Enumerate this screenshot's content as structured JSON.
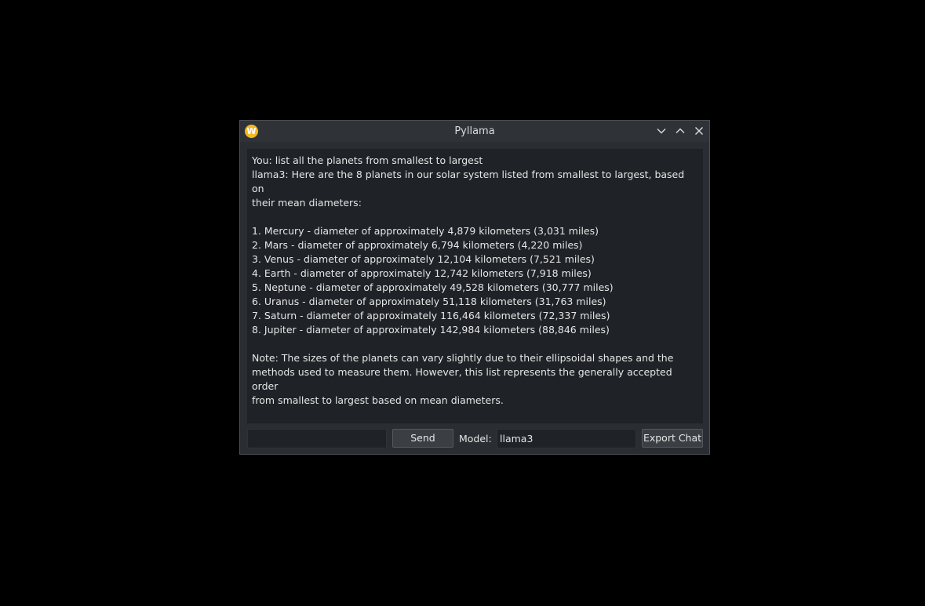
{
  "window": {
    "title": "Pyllama",
    "app_icon": {
      "name": "app-logo-icon",
      "glyph": "W",
      "color": "#f5b81e"
    }
  },
  "title_controls": {
    "minimize_icon": "chevron-down-icon",
    "maximize_icon": "chevron-up-icon",
    "close_icon": "close-icon"
  },
  "chat": {
    "lines": [
      "You: list all the planets from smallest to largest",
      "llama3: Here are the 8 planets in our solar system listed from smallest to largest, based on",
      "their mean diameters:",
      "",
      "1. Mercury - diameter of approximately 4,879 kilometers (3,031 miles)",
      "2. Mars - diameter of approximately 6,794 kilometers (4,220 miles)",
      "3. Venus - diameter of approximately 12,104 kilometers (7,521 miles)",
      "4. Earth - diameter of approximately 12,742 kilometers (7,918 miles)",
      "5. Neptune - diameter of approximately 49,528 kilometers (30,777 miles)",
      "6. Uranus - diameter of approximately 51,118 kilometers (31,763 miles)",
      "7. Saturn - diameter of approximately 116,464 kilometers (72,337 miles)",
      "8. Jupiter - diameter of approximately 142,984 kilometers (88,846 miles)",
      "",
      "Note: The sizes of the planets can vary slightly due to their ellipsoidal shapes and the",
      "methods used to measure them. However, this list represents the generally accepted order",
      "from smallest to largest based on mean diameters."
    ]
  },
  "input": {
    "message_value": "",
    "send_label": "Send",
    "model_label": "Model:",
    "model_value": "llama3",
    "export_label": "Export Chat"
  },
  "colors": {
    "background": "#000000",
    "window": "#2a2e32",
    "chat_bg": "#1f2226",
    "text": "#e6e6e6"
  }
}
